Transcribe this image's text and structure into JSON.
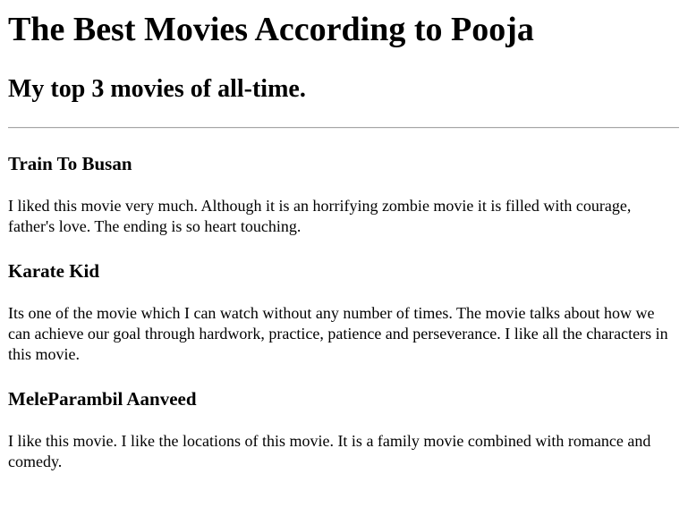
{
  "page": {
    "title": "The Best Movies According to Pooja",
    "subtitle": "My top 3 movies of all-time."
  },
  "movies": [
    {
      "name": "Train To Busan",
      "review": "I liked this movie very much. Although it is an horrifying zombie movie it is filled with courage, father's love. The ending is so heart touching."
    },
    {
      "name": "Karate Kid",
      "review": "Its one of the movie which I can watch without any number of times. The movie talks about how we can achieve our goal through hardwork, practice, patience and perseverance. I like all the characters in this movie."
    },
    {
      "name": "MeleParambil Aanveed",
      "review": "I like this movie. I like the locations of this movie. It is a family movie combined with romance and comedy."
    }
  ]
}
